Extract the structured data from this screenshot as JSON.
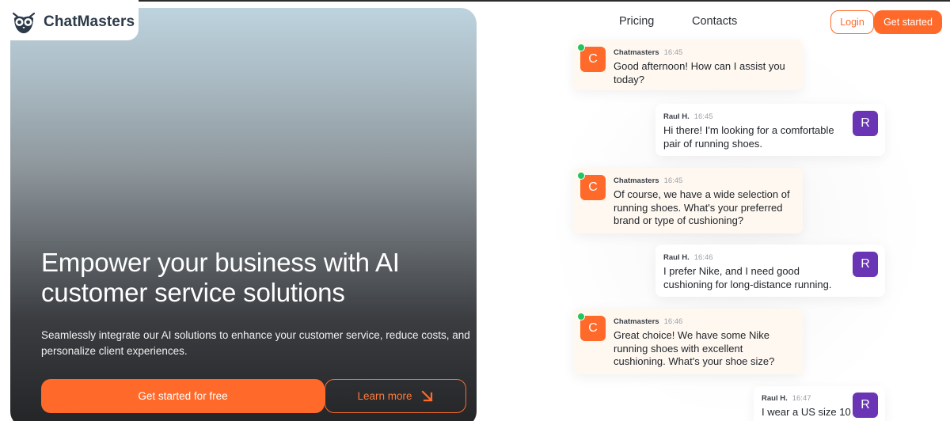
{
  "brand": {
    "name": "ChatMasters"
  },
  "nav": {
    "links": [
      "Pricing",
      "Contacts"
    ],
    "login": "Login",
    "get_started": "Get started"
  },
  "hero": {
    "title": "Empower your business with AI customer service solutions",
    "subtitle": "Seamlessly integrate our AI solutions to enhance your customer service, reduce costs, and personalize client experiences.",
    "cta_primary": "Get started for free",
    "cta_secondary": "Learn more"
  },
  "chat": {
    "messages": [
      {
        "sender": "Chatmasters",
        "time": "16:45",
        "avatar": "C",
        "role": "bot",
        "text": "Good afternoon! How can I assist you today?"
      },
      {
        "sender": "Raul H.",
        "time": "16:45",
        "avatar": "R",
        "role": "user",
        "text": "Hi there! I'm looking for a comfortable pair of running shoes."
      },
      {
        "sender": "Chatmasters",
        "time": "16:45",
        "avatar": "C",
        "role": "bot",
        "text": "Of course, we have a wide selection of running shoes. What's your preferred brand or type of cushioning?"
      },
      {
        "sender": "Raul H.",
        "time": "16:46",
        "avatar": "R",
        "role": "user",
        "text": "I prefer Nike, and I need good cushioning for long-distance running."
      },
      {
        "sender": "Chatmasters",
        "time": "16:46",
        "avatar": "C",
        "role": "bot",
        "text": "Great choice! We have some Nike running shoes with excellent cushioning. What's your shoe size?"
      },
      {
        "sender": "Raul H.",
        "time": "16:47",
        "avatar": "R",
        "role": "user",
        "text": "I wear a US size 10"
      }
    ]
  },
  "colors": {
    "accent": "#ff6a2a",
    "user_avatar": "#6a35b5",
    "online": "#22c55e"
  },
  "icons": {
    "logo": "owl-logo-icon",
    "learn_more": "arrow-down-right-icon"
  }
}
